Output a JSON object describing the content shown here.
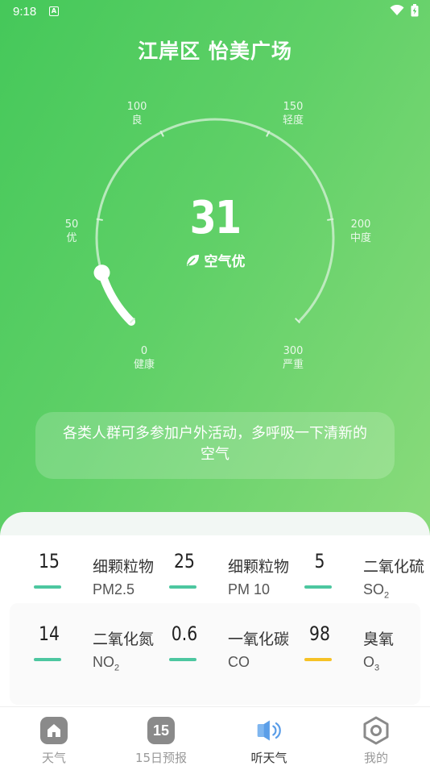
{
  "status_bar": {
    "time": "9:18",
    "notif": "A"
  },
  "location": {
    "title": "江岸区 怡美广场"
  },
  "gauge": {
    "value": "31",
    "level": "空气优",
    "labels": [
      {
        "value": "0",
        "text": "健康"
      },
      {
        "value": "50",
        "text": "优"
      },
      {
        "value": "100",
        "text": "良"
      },
      {
        "value": "150",
        "text": "轻度"
      },
      {
        "value": "200",
        "text": "中度"
      },
      {
        "value": "300",
        "text": "严重"
      }
    ],
    "max": 300,
    "colors": {
      "track": "#d8f2da",
      "progress": "#ffffff"
    }
  },
  "advice": "各类人群可多参加户外活动，多呼吸一下清新的空气",
  "pollutants": [
    {
      "value": "15",
      "name": "细颗粒物",
      "code": "PM2.5",
      "sub": "",
      "color": "#4dc7a0"
    },
    {
      "value": "25",
      "name": "细颗粒物",
      "code": "PM 10",
      "sub": "",
      "color": "#4dc7a0"
    },
    {
      "value": "5",
      "name": "二氧化硫",
      "code": "SO",
      "sub": "2",
      "color": "#4dc7a0"
    },
    {
      "value": "14",
      "name": "二氧化氮",
      "code": "NO",
      "sub": "2",
      "color": "#4dc7a0"
    },
    {
      "value": "0.6",
      "name": "一氧化碳",
      "code": "CO",
      "sub": "",
      "color": "#4dc7a0"
    },
    {
      "value": "98",
      "name": "臭氧",
      "code": "O",
      "sub": "3",
      "color": "#f6c226"
    }
  ],
  "tabs": [
    {
      "label": "天气",
      "icon": "home-icon"
    },
    {
      "label": "15日预报",
      "icon_text": "15"
    },
    {
      "label": "听天气",
      "icon": "speaker-icon"
    },
    {
      "label": "我的",
      "icon": "hexagon-settings-icon"
    }
  ]
}
